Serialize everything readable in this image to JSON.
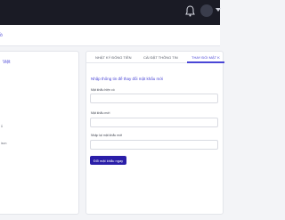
{
  "breadcrumb": {
    "text": "ồ"
  },
  "profile": {
    "name": "Việt",
    "lines": [
      "ỗ",
      "ison"
    ]
  },
  "tabs": [
    {
      "label": "NHẬT KÝ ĐÓNG TIỀN",
      "active": false
    },
    {
      "label": "CÀI ĐẶT THÔNG TIN",
      "active": false
    },
    {
      "label": "THAY ĐỔI MẬT K",
      "active": true
    }
  ],
  "form": {
    "title": "Nhập thông tin để thay đổi mật khẩu mới",
    "fields": [
      {
        "label": "Mật khẩu hiện có",
        "value": ""
      },
      {
        "label": "Mật khẩu mới",
        "value": ""
      },
      {
        "label": "Nhập lại mật khẩu mới",
        "value": ""
      }
    ],
    "submit_label": "Đổi mật khẩu ngay"
  },
  "colors": {
    "accent": "#4a46d6",
    "topbar": "#1a1b25",
    "button": "#2a1ea8"
  },
  "icons": {
    "notification": "bell-icon",
    "user": "avatar",
    "menu": "chevron-down-icon"
  }
}
